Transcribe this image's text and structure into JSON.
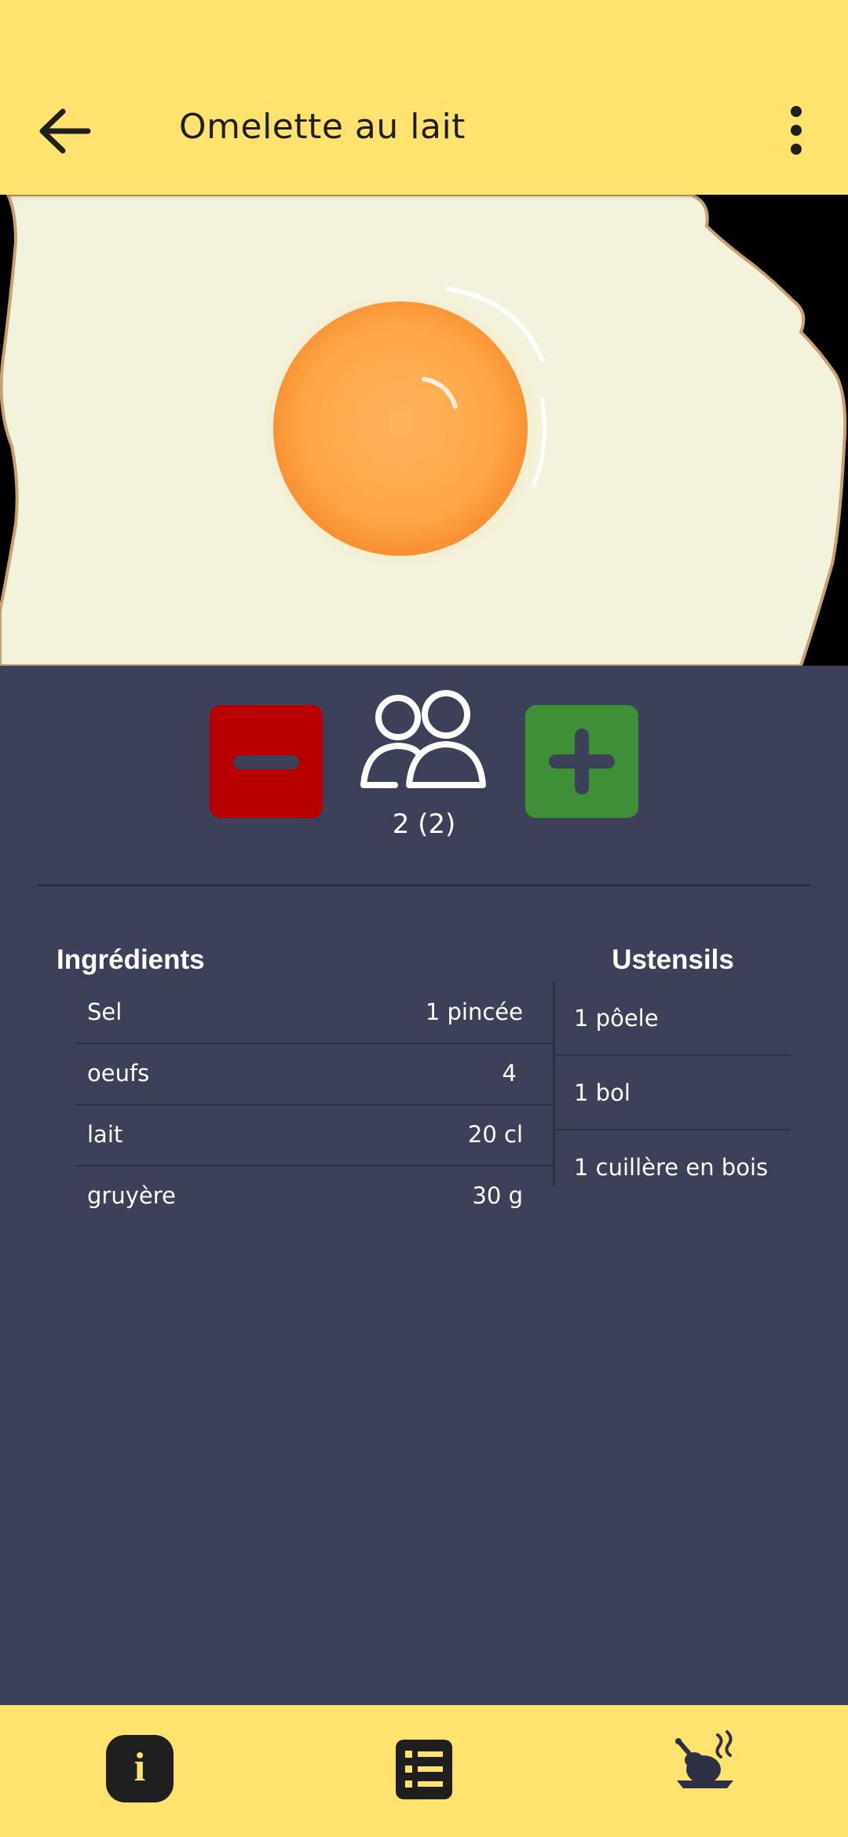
{
  "appbar": {
    "title": "Omelette au lait",
    "back_icon": "arrow-left-icon",
    "menu_icon": "more-vertical-icon"
  },
  "hero": {
    "image": "fried-egg-photo"
  },
  "servings": {
    "count_label": "2 (2)",
    "minus_icon": "minus-icon",
    "plus_icon": "plus-icon",
    "people_icon": "people-icon",
    "colors": {
      "minus": "#b80000",
      "plus": "#3e8f36"
    }
  },
  "ingredients": {
    "title": "Ingrédients",
    "items": [
      {
        "name": "Sel",
        "qty": "1 pincée"
      },
      {
        "name": "oeufs",
        "qty": "4"
      },
      {
        "name": "lait",
        "qty": "20 cl"
      },
      {
        "name": "gruyère",
        "qty": "30 g"
      }
    ]
  },
  "utensils": {
    "title": "Ustensils",
    "items": [
      {
        "name": "1 pôele"
      },
      {
        "name": "1 bol"
      },
      {
        "name": "1 cuillère en bois"
      }
    ]
  },
  "bottom_nav": {
    "items": [
      {
        "icon": "info-icon",
        "glyph": "i"
      },
      {
        "icon": "list-icon"
      },
      {
        "icon": "cooking-icon"
      }
    ]
  },
  "colors": {
    "accent": "#ffe36e",
    "background": "#3d4059"
  }
}
